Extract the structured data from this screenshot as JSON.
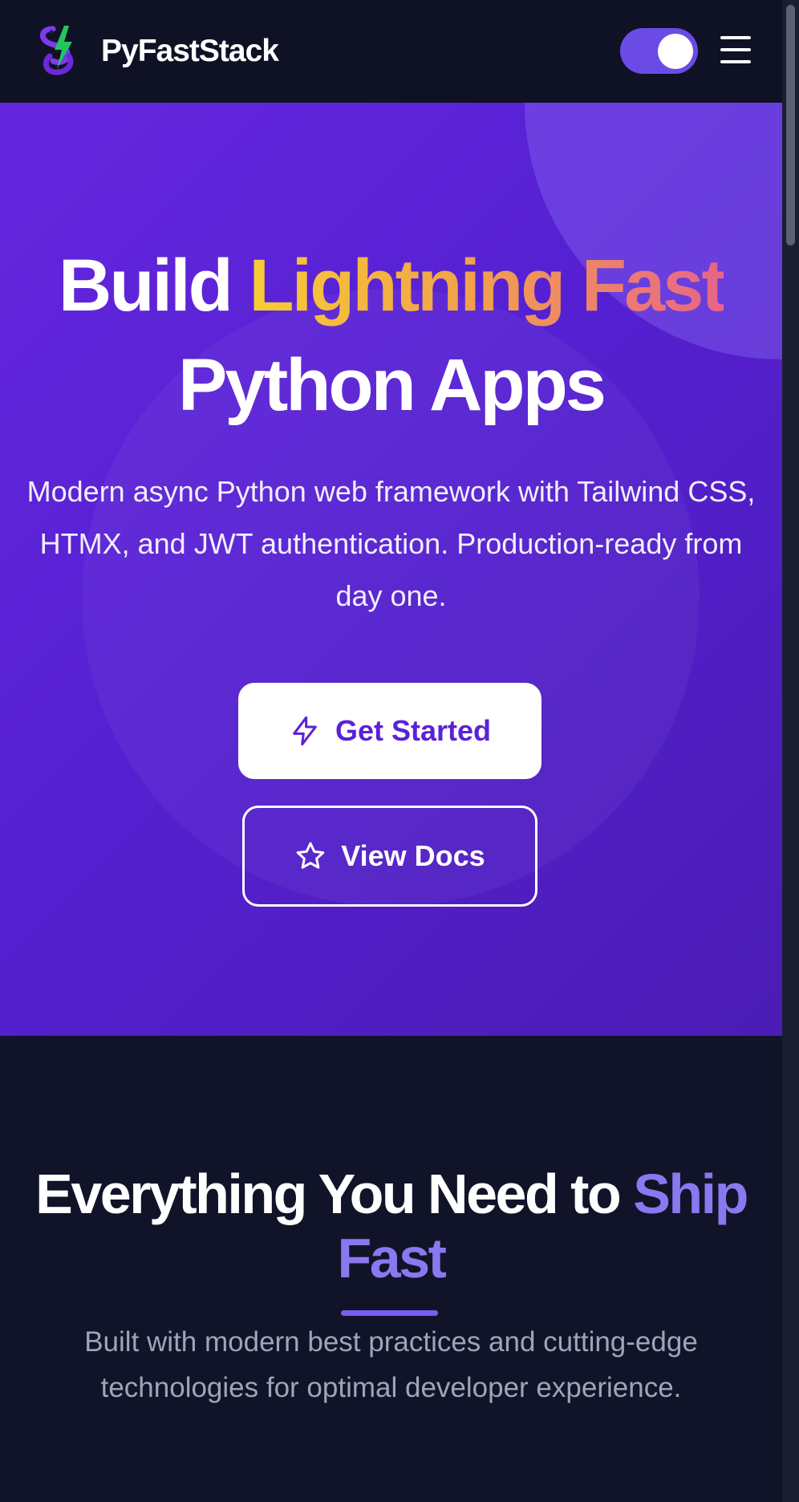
{
  "header": {
    "brand": "PyFastStack",
    "logo_icon": "python-lightning-logo",
    "theme_toggle_state": "on",
    "menu_icon": "hamburger-menu-icon"
  },
  "hero": {
    "title_part1": "Build ",
    "title_highlight": "Lightning Fast",
    "title_line2": "Python Apps",
    "subtitle": "Modern async Python web framework with Tailwind CSS, HTMX, and JWT authentication. Production-ready from day one.",
    "primary_button": {
      "label": "Get Started",
      "icon": "lightning-bolt-icon"
    },
    "secondary_button": {
      "label": "View Docs",
      "icon": "star-icon"
    }
  },
  "features": {
    "title_part1": "Everything You Need to ",
    "title_accent": "Ship Fast",
    "subtitle": "Built with modern best practices and cutting-edge technologies for optimal developer experience."
  },
  "colors": {
    "page_bg": "#111428",
    "header_bg": "#0f1224",
    "hero_gradient_start": "#6527de",
    "hero_gradient_end": "#4a1cb4",
    "accent_purple": "#8b78f0",
    "toggle_bg": "#6a4be6",
    "highlight_gradient": [
      "#f7cc35",
      "#f1a34a",
      "#e8648a"
    ]
  }
}
